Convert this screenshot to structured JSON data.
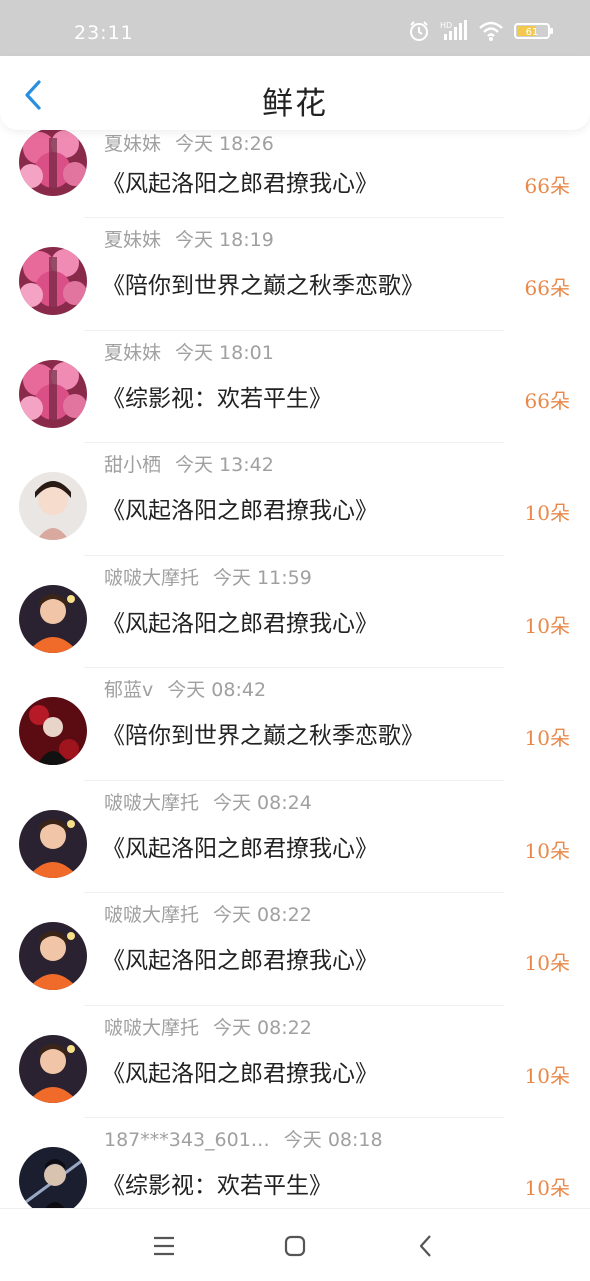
{
  "status_bar": {
    "time": "23:11",
    "battery": "61",
    "icons": [
      "alarm-icon",
      "hd-signal-icon",
      "wifi-icon",
      "battery-icon"
    ]
  },
  "header": {
    "title": "鲜花",
    "back_icon": "chevron-left-icon"
  },
  "colors": {
    "accent": "#2a8fe0",
    "flower_count": "#e8894a",
    "meta_text": "#a0a0a0",
    "status_bar": "#cfcfcf"
  },
  "records": [
    {
      "name": "夏妹妹",
      "time": "今天 18:26",
      "book": "《风起洛阳之郎君撩我心》",
      "count": "66朵",
      "avatar": "pink-blossom"
    },
    {
      "name": "夏妹妹",
      "time": "今天 18:19",
      "book": "《陪你到世界之巅之秋季恋歌》",
      "count": "66朵",
      "avatar": "pink-blossom"
    },
    {
      "name": "夏妹妹",
      "time": "今天 18:01",
      "book": "《综影视：欢若平生》",
      "count": "66朵",
      "avatar": "pink-blossom"
    },
    {
      "name": "甜小栖",
      "time": "今天 13:42",
      "book": "《风起洛阳之郎君撩我心》",
      "count": "10朵",
      "avatar": "girl-portrait"
    },
    {
      "name": "啵啵大摩托",
      "time": "今天 11:59",
      "book": "《风起洛阳之郎君撩我心》",
      "count": "10朵",
      "avatar": "orange-hoodie"
    },
    {
      "name": "郁蓝v",
      "time": "今天 08:42",
      "book": "《陪你到世界之巅之秋季恋歌》",
      "count": "10朵",
      "avatar": "dark-red"
    },
    {
      "name": "啵啵大摩托",
      "time": "今天 08:24",
      "book": "《风起洛阳之郎君撩我心》",
      "count": "10朵",
      "avatar": "orange-hoodie"
    },
    {
      "name": "啵啵大摩托",
      "time": "今天 08:22",
      "book": "《风起洛阳之郎君撩我心》",
      "count": "10朵",
      "avatar": "orange-hoodie"
    },
    {
      "name": "啵啵大摩托",
      "time": "今天 08:22",
      "book": "《风起洛阳之郎君撩我心》",
      "count": "10朵",
      "avatar": "orange-hoodie"
    },
    {
      "name": "187***343_601…",
      "time": "今天 08:18",
      "book": "《综影视：欢若平生》",
      "count": "10朵",
      "avatar": "dark-swordsman"
    }
  ],
  "nav_bar": {
    "buttons": [
      "menu-icon",
      "home-square-icon",
      "back-triangle-icon"
    ]
  }
}
